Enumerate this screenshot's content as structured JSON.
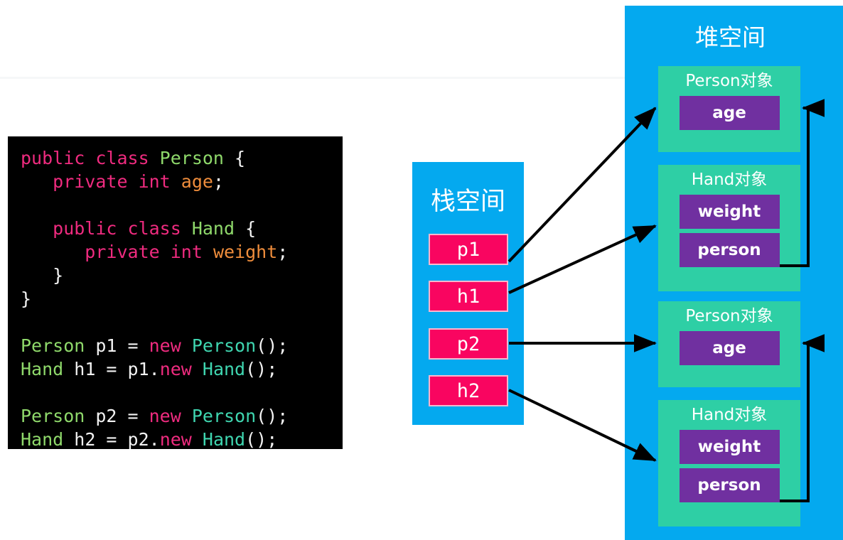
{
  "diagram": {
    "title_stack": "栈空间",
    "title_heap": "堆空间"
  },
  "code": {
    "lines": [
      [
        {
          "t": "public class ",
          "c": "kw"
        },
        {
          "t": "Person",
          "c": "typ"
        },
        {
          "t": " {",
          "c": "pln"
        }
      ],
      [
        {
          "t": "   private int ",
          "c": "kw"
        },
        {
          "t": "age",
          "c": "fld"
        },
        {
          "t": ";",
          "c": "pln"
        }
      ],
      [],
      [
        {
          "t": "   public class ",
          "c": "kw"
        },
        {
          "t": "Hand",
          "c": "typ"
        },
        {
          "t": " {",
          "c": "pln"
        }
      ],
      [
        {
          "t": "      private int ",
          "c": "kw"
        },
        {
          "t": "weight",
          "c": "fld"
        },
        {
          "t": ";",
          "c": "pln"
        }
      ],
      [
        {
          "t": "   }",
          "c": "pln"
        }
      ],
      [
        {
          "t": "}",
          "c": "pln"
        }
      ],
      [],
      [
        {
          "t": "Person",
          "c": "typ"
        },
        {
          "t": " p1 = ",
          "c": "pln"
        },
        {
          "t": "new ",
          "c": "kw"
        },
        {
          "t": "Person",
          "c": "ctor"
        },
        {
          "t": "();",
          "c": "pln"
        }
      ],
      [
        {
          "t": "Hand",
          "c": "typ"
        },
        {
          "t": " h1 = p1.",
          "c": "pln"
        },
        {
          "t": "new ",
          "c": "kw"
        },
        {
          "t": "Hand",
          "c": "ctor"
        },
        {
          "t": "();",
          "c": "pln"
        }
      ],
      [],
      [
        {
          "t": "Person",
          "c": "typ"
        },
        {
          "t": " p2 = ",
          "c": "pln"
        },
        {
          "t": "new ",
          "c": "kw"
        },
        {
          "t": "Person",
          "c": "ctor"
        },
        {
          "t": "();",
          "c": "pln"
        }
      ],
      [
        {
          "t": "Hand",
          "c": "typ"
        },
        {
          "t": " h2 = p2.",
          "c": "pln"
        },
        {
          "t": "new ",
          "c": "kw"
        },
        {
          "t": "Hand",
          "c": "ctor"
        },
        {
          "t": "();",
          "c": "pln"
        }
      ]
    ]
  },
  "stack": {
    "slots": [
      {
        "label": "p1"
      },
      {
        "label": "h1"
      },
      {
        "label": "p2"
      },
      {
        "label": "h2"
      }
    ]
  },
  "heap": {
    "objects": [
      {
        "title": "Person对象",
        "fields": [
          "age"
        ]
      },
      {
        "title": "Hand对象",
        "fields": [
          "weight",
          "person"
        ]
      },
      {
        "title": "Person对象",
        "fields": [
          "age"
        ]
      },
      {
        "title": "Hand对象",
        "fields": [
          "weight",
          "person"
        ]
      }
    ]
  },
  "colors": {
    "heap_bg": "#04a9ef",
    "stack_bg": "#04a9ef",
    "object_bg": "#2ecfa5",
    "field_bg": "#7030a0",
    "slot_bg": "#f90560",
    "slot_border": "#ffb6cd",
    "code_bg": "#000000",
    "arrow": "#000000",
    "keyword": "#ef2b7f",
    "type": "#8fd96b",
    "ctor": "#3fd6b0",
    "field_name": "#ef8d3c",
    "plain": "#f2f2f2"
  }
}
